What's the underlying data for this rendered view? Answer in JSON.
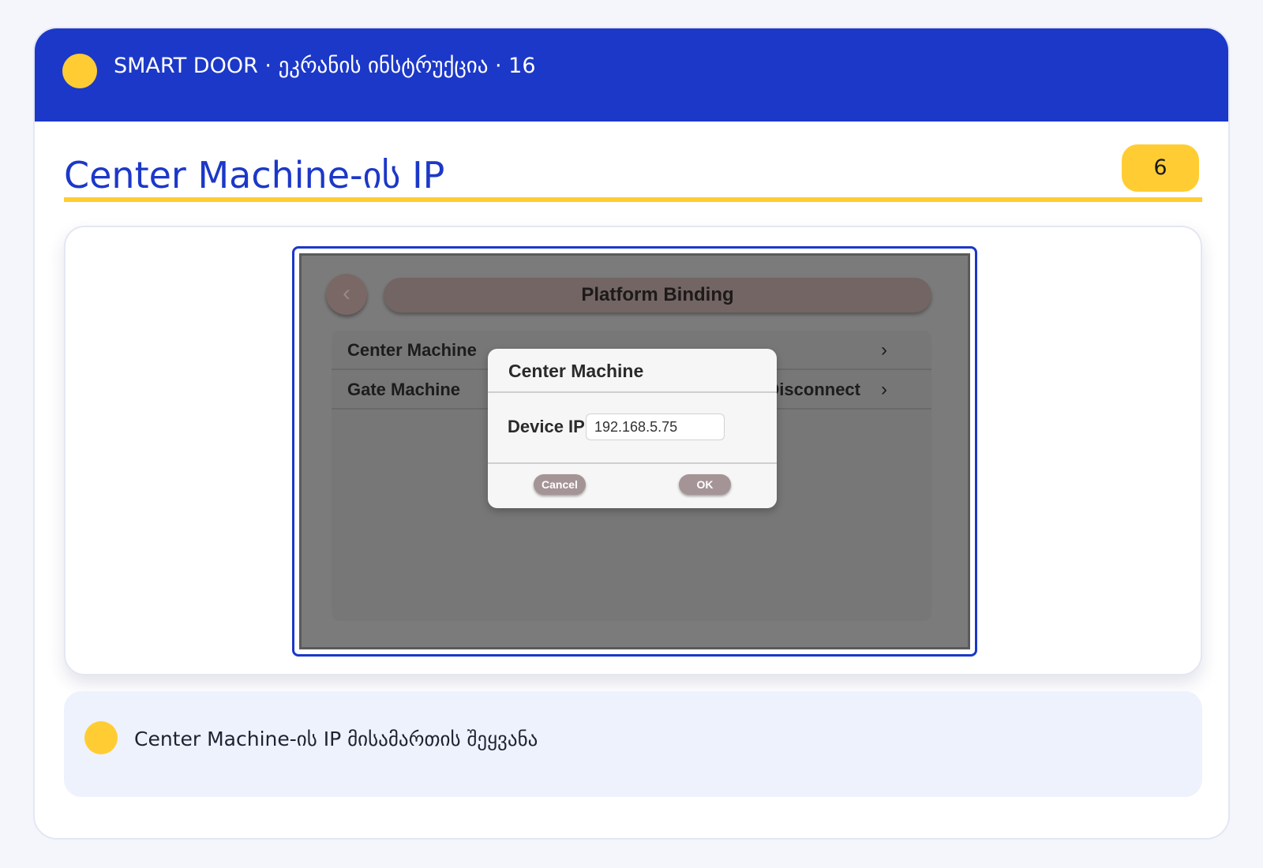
{
  "header": {
    "title": "SMART DOOR · ეკრანის ინსტრუქცია · 16"
  },
  "page": {
    "title": "Center Machine-ის IP",
    "step_number": "6"
  },
  "device_screen": {
    "back_icon": "chevron-left-icon",
    "title": "Platform Binding",
    "rows": [
      {
        "label": "Center Machine",
        "status": "",
        "chevron": "›"
      },
      {
        "label": "Gate Machine",
        "status": "Disconnect",
        "chevron": "›"
      }
    ],
    "dialog": {
      "title": "Center Machine",
      "field_label": "Device IP",
      "ip_value": "192.168.5.75",
      "cancel_label": "Cancel",
      "ok_label": "OK"
    }
  },
  "note": {
    "text": "Center Machine-ის IP მისამართის შეყვანა"
  },
  "colors": {
    "brand_blue": "#1c38c8",
    "accent_yellow": "#ffcd33"
  }
}
